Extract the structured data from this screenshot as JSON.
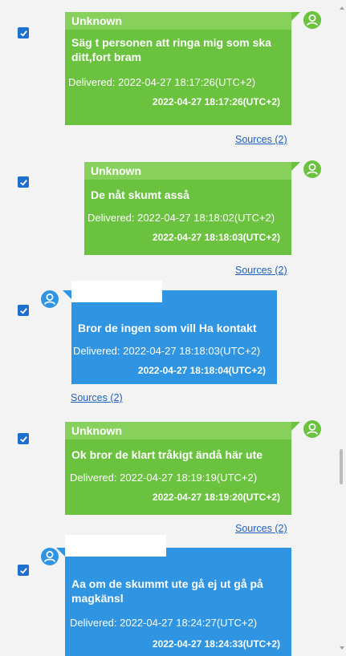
{
  "colors": {
    "green": "#6ac23e",
    "green_header": "#87d05b",
    "blue": "#2f95e3",
    "link": "#1f5fbf",
    "checkbox": "#1f6fce"
  },
  "messages": [
    {
      "direction": "outgoing",
      "checked": true,
      "sender": "Unknown",
      "text": "Säg t personen att ringa mig som ska ditt,fort bram",
      "delivered": "Delivered: 2022-04-27 18:17:26(UTC+2)",
      "timestamp": "2022-04-27 18:17:26(UTC+2)",
      "sources": "Sources (2)"
    },
    {
      "direction": "outgoing",
      "checked": true,
      "sender": "Unknown",
      "text": "De nåt skumt asså",
      "delivered": "Delivered: 2022-04-27 18:18:02(UTC+2)",
      "timestamp": "2022-04-27 18:18:03(UTC+2)",
      "sources": "Sources (2)"
    },
    {
      "direction": "incoming",
      "checked": true,
      "sender": "",
      "text": "Bror de ingen som vill Ha kontakt",
      "delivered": "Delivered: 2022-04-27 18:18:03(UTC+2)",
      "timestamp": "2022-04-27 18:18:04(UTC+2)",
      "sources": "Sources (2)"
    },
    {
      "direction": "outgoing",
      "checked": true,
      "sender": "Unknown",
      "text": "Ok bror de klart tråkigt ändå här ute",
      "delivered": "Delivered: 2022-04-27 18:19:19(UTC+2)",
      "timestamp": "2022-04-27 18:19:20(UTC+2)",
      "sources": "Sources (2)"
    },
    {
      "direction": "incoming",
      "checked": true,
      "sender": "",
      "text": "Aa om de skummt ute gå ej ut gå på magkänsl",
      "delivered": "Delivered: 2022-04-27 18:24:27(UTC+2)",
      "timestamp": "2022-04-27 18:24:33(UTC+2)",
      "sources": ""
    }
  ],
  "icons": {
    "checkbox": "checkmark-icon",
    "avatar": "user-avatar-icon"
  }
}
